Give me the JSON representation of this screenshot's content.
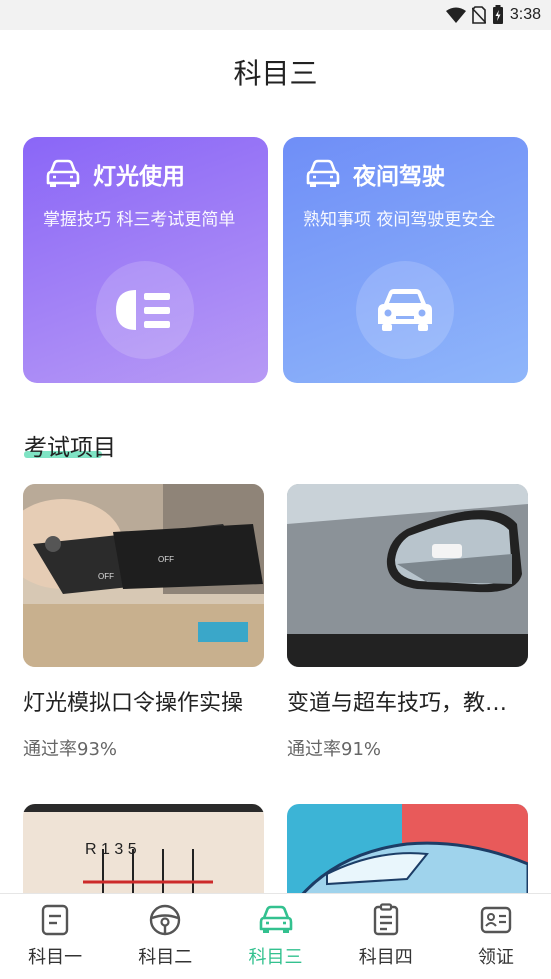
{
  "status_bar": {
    "time": "3:38"
  },
  "page": {
    "title": "科目三"
  },
  "feature_cards": [
    {
      "title": "灯光使用",
      "subtitle": "掌握技巧 科三考试更简单",
      "icon": "headlight-icon"
    },
    {
      "title": "夜间驾驶",
      "subtitle": "熟知事项 夜间驾驶更安全",
      "icon": "car-front-icon"
    }
  ],
  "section": {
    "title": "考试项目"
  },
  "items": [
    {
      "title": "灯光模拟口令操作实操",
      "pass_rate": "通过率93%"
    },
    {
      "title": "变道与超车技巧，教练讲解",
      "pass_rate": "通过率91%"
    },
    {
      "title": "",
      "pass_rate": ""
    },
    {
      "title": "",
      "pass_rate": ""
    }
  ],
  "tabs": [
    {
      "label": "科目一",
      "icon": "document-icon",
      "active": false
    },
    {
      "label": "科目二",
      "icon": "steering-wheel-icon",
      "active": false
    },
    {
      "label": "科目三",
      "icon": "car-icon",
      "active": true
    },
    {
      "label": "科目四",
      "icon": "checklist-icon",
      "active": false
    },
    {
      "label": "领证",
      "icon": "id-card-icon",
      "active": false
    }
  ],
  "colors": {
    "accent": "#33c18f",
    "card_purple": "#8a66f7",
    "card_blue": "#6f8ef7"
  }
}
